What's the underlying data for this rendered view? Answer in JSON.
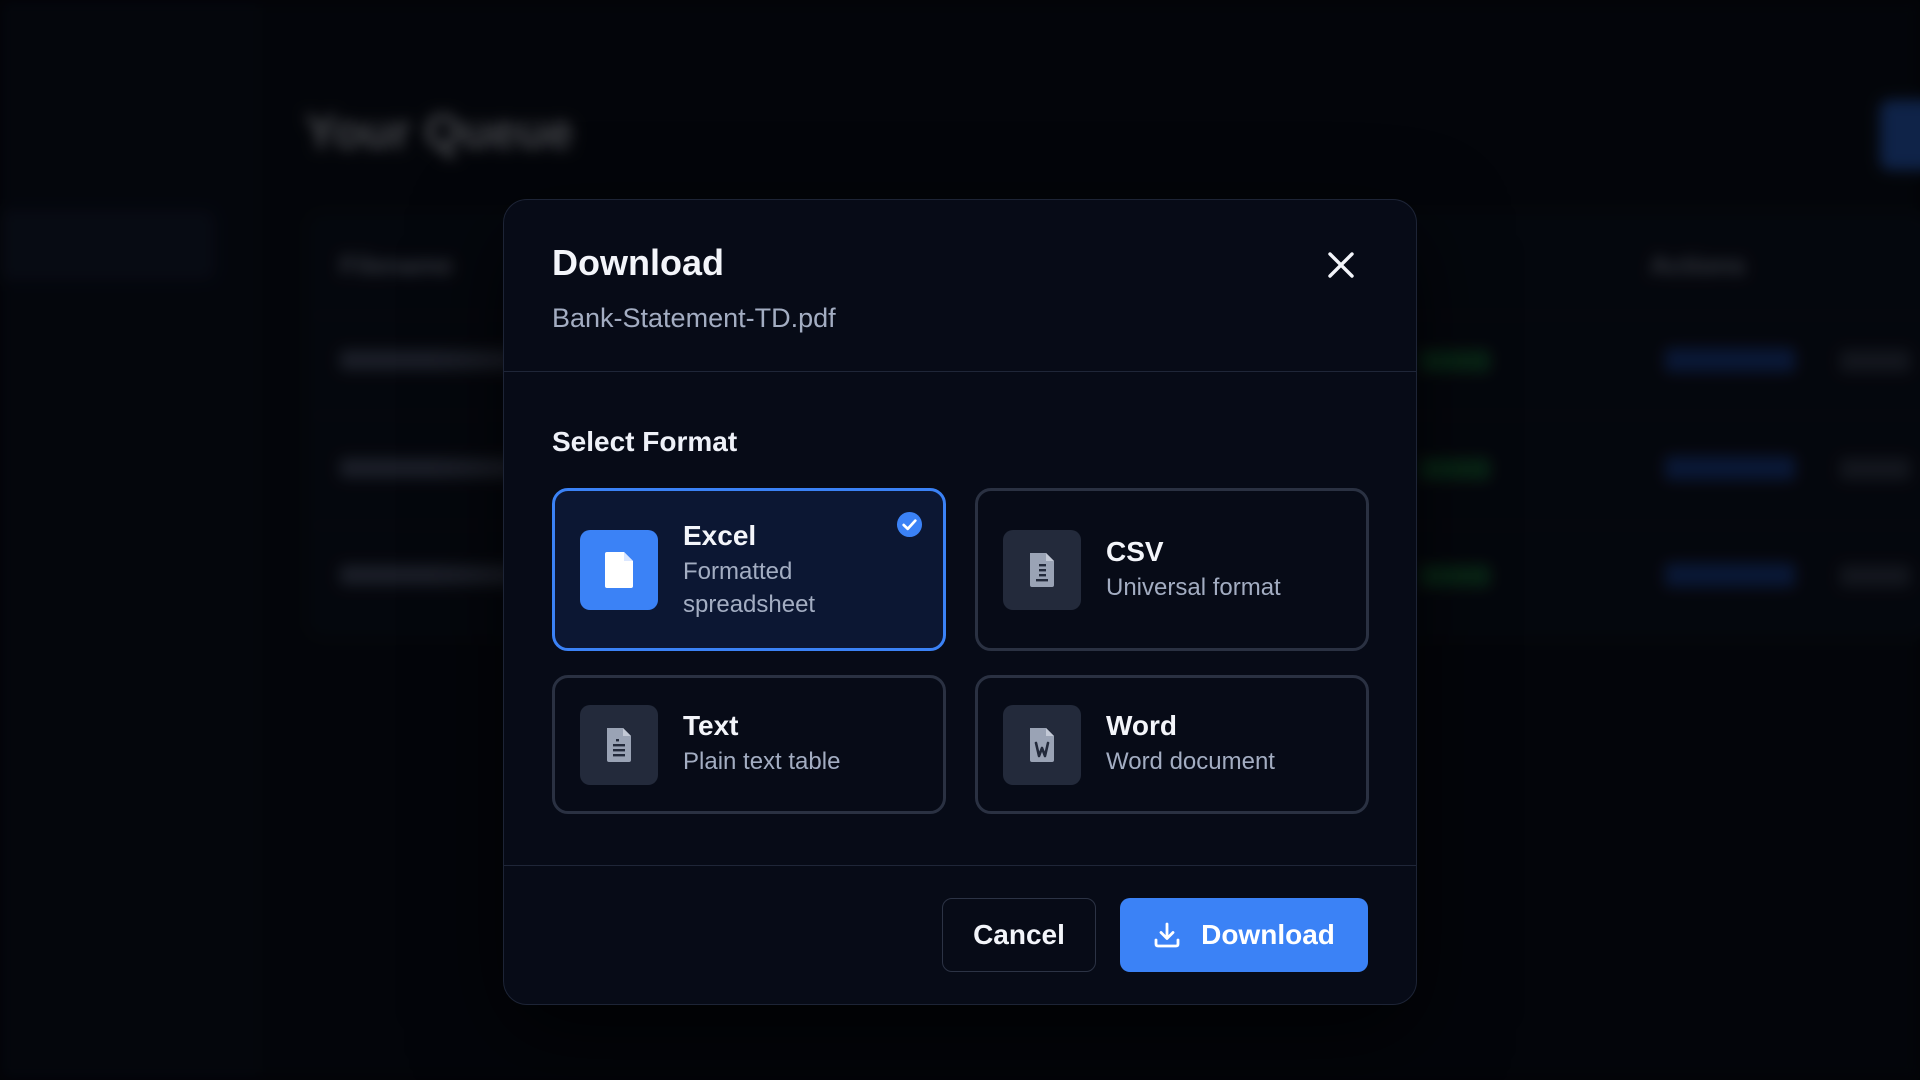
{
  "background": {
    "page_title": "Your Queue",
    "table_headers": [
      "Filename",
      "Actions"
    ]
  },
  "dialog": {
    "title": "Download",
    "filename": "Bank-Statement-TD.pdf",
    "close_icon": "close-icon",
    "section_label": "Select Format",
    "selected_format": "Excel",
    "formats": [
      {
        "title": "Excel",
        "description": "Formatted spreadsheet",
        "icon": "file-icon",
        "selected": true
      },
      {
        "title": "CSV",
        "description": "Universal format",
        "icon": "file-lines-icon",
        "selected": false
      },
      {
        "title": "Text",
        "description": "Plain text table",
        "icon": "file-text-icon",
        "selected": false
      },
      {
        "title": "Word",
        "description": "Word document",
        "icon": "file-word-icon",
        "selected": false
      }
    ],
    "cancel_label": "Cancel",
    "download_label": "Download",
    "download_icon": "download-icon"
  },
  "colors": {
    "accent": "#3b82f6",
    "modal_background": "#070b17",
    "card_border": "#2a3142",
    "text_primary": "#f3f5fa",
    "text_secondary": "#a3adc2",
    "status_green": "#19743c"
  }
}
